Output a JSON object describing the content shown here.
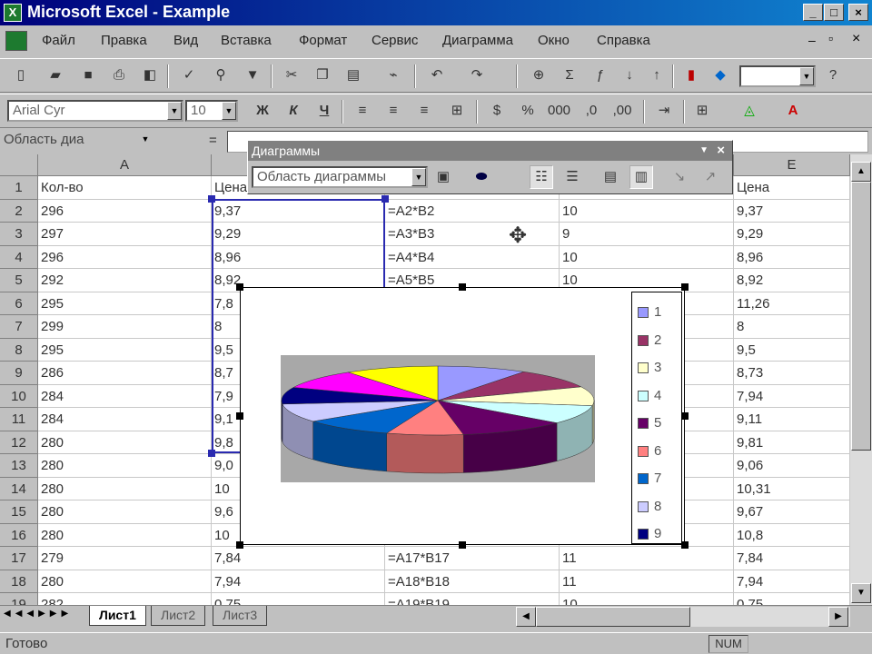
{
  "window": {
    "title": "Microsoft Excel - Example"
  },
  "menu": [
    "Файл",
    "Правка",
    "Вид",
    "Вставка",
    "Формат",
    "Сервис",
    "Диаграмма",
    "Окно",
    "Справка"
  ],
  "format_toolbar": {
    "font": "Arial Cyr",
    "size": "10",
    "bold": "Ж",
    "italic": "К",
    "underline": "Ч"
  },
  "formula_bar": {
    "name_box": "Область диа",
    "fx": "="
  },
  "chart_toolbar": {
    "title": "Диаграммы",
    "element_select": "Область диаграммы"
  },
  "columns": [
    "A",
    "B",
    "C",
    "D",
    "E"
  ],
  "row_numbers": [
    "1",
    "2",
    "3",
    "4",
    "5",
    "6",
    "7",
    "8",
    "9",
    "10",
    "11",
    "12",
    "13",
    "14",
    "15",
    "16",
    "17",
    "18",
    "19"
  ],
  "headers": {
    "a": "Кол-во",
    "b": "Цена",
    "e": "Цена"
  },
  "rows": [
    {
      "a": "296",
      "b": "9,37",
      "c": "=A2*B2",
      "d": "10",
      "e": "9,37"
    },
    {
      "a": "297",
      "b": "9,29",
      "c": "=A3*B3",
      "d": "9",
      "e": "9,29"
    },
    {
      "a": "296",
      "b": "8,96",
      "c": "=A4*B4",
      "d": "10",
      "e": "8,96"
    },
    {
      "a": "292",
      "b": "8,92",
      "c": "=A5*B5",
      "d": "10",
      "e": "8,92"
    },
    {
      "a": "295",
      "b": "7,8",
      "c": "",
      "d": "",
      "e": "11,26"
    },
    {
      "a": "299",
      "b": "8",
      "c": "",
      "d": "",
      "e": "8"
    },
    {
      "a": "295",
      "b": "9,5",
      "c": "",
      "d": "",
      "e": "9,5"
    },
    {
      "a": "286",
      "b": "8,7",
      "c": "",
      "d": "",
      "e": "8,73"
    },
    {
      "a": "284",
      "b": "7,9",
      "c": "",
      "d": "",
      "e": "7,94"
    },
    {
      "a": "284",
      "b": "9,1",
      "c": "",
      "d": "",
      "e": "9,11"
    },
    {
      "a": "280",
      "b": "9,8",
      "c": "",
      "d": "",
      "e": "9,81"
    },
    {
      "a": "280",
      "b": "9,0",
      "c": "",
      "d": "",
      "e": "9,06"
    },
    {
      "a": "280",
      "b": "10",
      "c": "",
      "d": "",
      "e": "10,31"
    },
    {
      "a": "280",
      "b": "9,6",
      "c": "",
      "d": "",
      "e": "9,67"
    },
    {
      "a": "280",
      "b": "10",
      "c": "",
      "d": "",
      "e": "10,8"
    },
    {
      "a": "279",
      "b": "7,84",
      "c": "=A17*B17",
      "d": "11",
      "e": "7,84"
    },
    {
      "a": "280",
      "b": "7,94",
      "c": "=A18*B18",
      "d": "11",
      "e": "7,94"
    },
    {
      "a": "282",
      "b": "0,75",
      "c": "=A19*B19",
      "d": "10",
      "e": "0,75"
    }
  ],
  "legend": [
    {
      "label": "1",
      "color": "#9999ff"
    },
    {
      "label": "2",
      "color": "#993366"
    },
    {
      "label": "3",
      "color": "#ffffcc"
    },
    {
      "label": "4",
      "color": "#ccffff"
    },
    {
      "label": "5",
      "color": "#660066"
    },
    {
      "label": "6",
      "color": "#ff8080"
    },
    {
      "label": "7",
      "color": "#0066cc"
    },
    {
      "label": "8",
      "color": "#ccccff"
    },
    {
      "label": "9",
      "color": "#000080"
    }
  ],
  "pie_slices": [
    {
      "color": "#9999ff",
      "value": 9.37
    },
    {
      "color": "#993366",
      "value": 9.29
    },
    {
      "color": "#ffffcc",
      "value": 8.96
    },
    {
      "color": "#ccffff",
      "value": 8.92
    },
    {
      "color": "#660066",
      "value": 11.26
    },
    {
      "color": "#ff8080",
      "value": 8
    },
    {
      "color": "#0066cc",
      "value": 9.5
    },
    {
      "color": "#ccccff",
      "value": 8.73
    },
    {
      "color": "#000080",
      "value": 7.94
    },
    {
      "color": "#ff00ff",
      "value": 9.11
    },
    {
      "color": "#ffff00",
      "value": 9.81
    }
  ],
  "sheets": [
    "Лист1",
    "Лист2",
    "Лист3"
  ],
  "status": {
    "ready": "Готово",
    "num": "NUM"
  }
}
